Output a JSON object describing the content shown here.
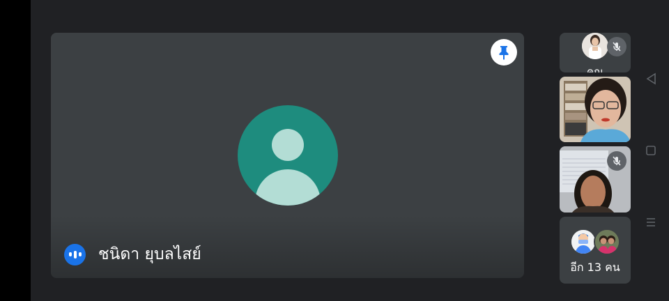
{
  "main": {
    "speaker_name": "ชนิดา ยุบลไสย์",
    "pin_icon": "pin-icon",
    "avatar_icon": "person-placeholder-avatar",
    "speaking_icon": "audio-level-icon"
  },
  "side": {
    "you_label": "คุณ",
    "more_label": "อีก 13 คน",
    "mute_icon": "mic-off-icon"
  },
  "nav": {
    "back_icon": "back-triangle-icon",
    "home_icon": "home-square-icon",
    "recents_icon": "menu-lines-icon"
  },
  "colors": {
    "background": "#202124",
    "tile": "#3c4043",
    "avatar_bg": "#1e8c7e",
    "avatar_fg": "#b3ddd5",
    "speaking": "#1a73e8",
    "pin": "#1a73e8"
  }
}
